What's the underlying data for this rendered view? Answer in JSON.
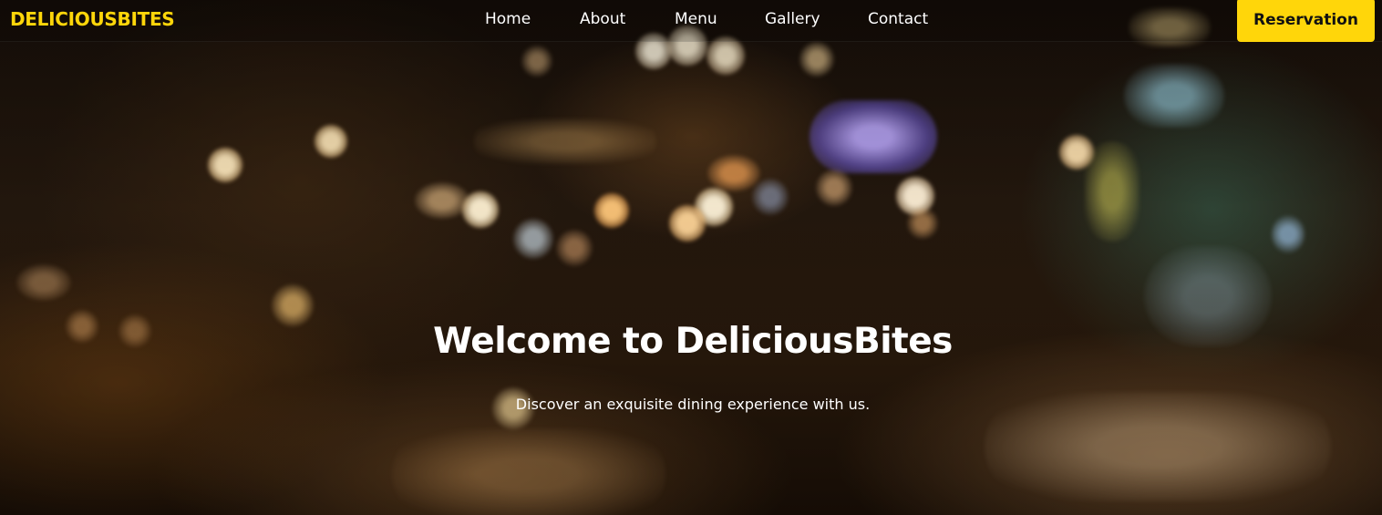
{
  "navbar": {
    "brand": "DELICIOUSBITES",
    "links": [
      {
        "label": "Home"
      },
      {
        "label": "About"
      },
      {
        "label": "Menu"
      },
      {
        "label": "Gallery"
      },
      {
        "label": "Contact"
      }
    ],
    "reservation_label": "Reservation"
  },
  "hero": {
    "title": "Welcome to DeliciousBites",
    "subtitle": "Discover an exquisite dining experience with us."
  },
  "colors": {
    "accent": "#ffd60a",
    "text": "#ffffff",
    "button_text": "#111111"
  }
}
